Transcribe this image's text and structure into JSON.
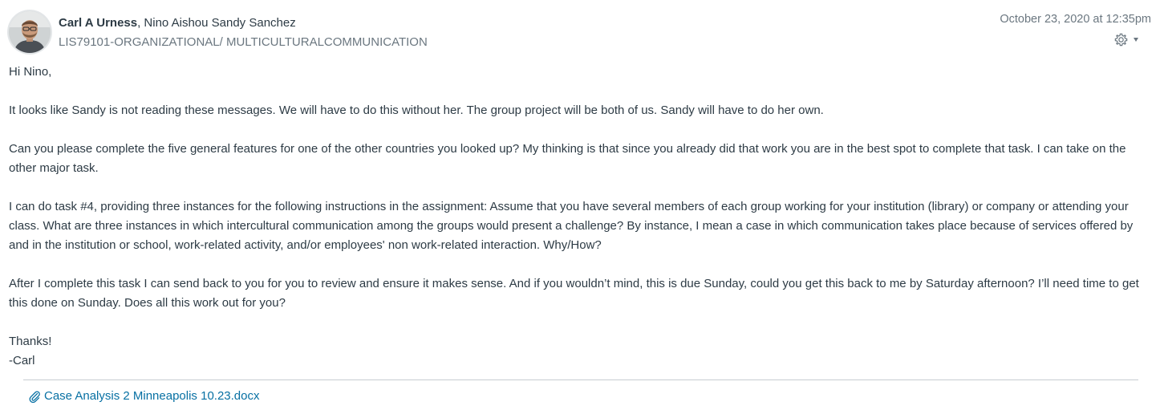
{
  "header": {
    "author": "Carl A Urness",
    "recipients": ", Nino Aishou Sandy Sanchez",
    "course": "LIS79101-ORGANIZATIONAL/ MULTICULTURALCOMMUNICATION",
    "timestamp": "October 23, 2020 at 12:35pm",
    "settings_icon": "gear-icon",
    "settings_caret_icon": "caret-down-icon"
  },
  "message": {
    "greeting": "Hi Nino,",
    "paragraph_1": "It looks like Sandy is not reading these messages. We will have to do this without her. The group project will be both of us. Sandy will have to do her own.",
    "paragraph_2": "Can you please complete the five general features for one of the other countries you looked up? My thinking is that since you already did that work you are in the best spot to complete that task. I can take on the other major task.",
    "paragraph_3": "I can do task #4, providing three instances for the following instructions in the assignment: Assume that you have several members of each group working for your institution (library) or company or attending your class. What are three instances in which intercultural communication among the groups would present a challenge? By instance, I mean a case in which communication takes place because of services offered by and in the institution or school, work-related activity, and/or employees' non work-related interaction. Why/How?",
    "paragraph_4": "After I complete this task I can send back to you for you to review and ensure it makes sense. And if you wouldn’t mind, this is due Sunday, could you get this back to me by Saturday afternoon? I’ll need time to get this done on Sunday. Does all this work out for you?",
    "closing": "Thanks!",
    "signature": "-Carl"
  },
  "attachment": {
    "icon": "paperclip-icon",
    "filename": "Case Analysis 2 Minneapolis 10.23.docx"
  },
  "colors": {
    "text": "#2d3b45",
    "muted": "#6b7780",
    "link": "#0770a3",
    "divider": "#c7cdd1"
  }
}
